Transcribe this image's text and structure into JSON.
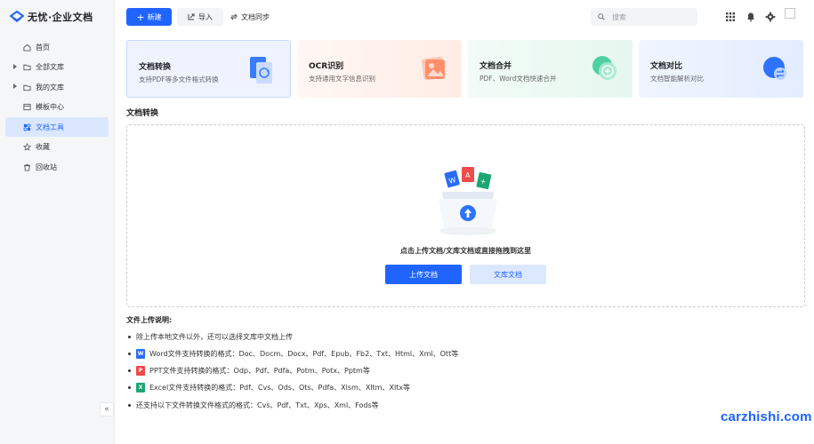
{
  "brand": {
    "name": "无忧·企业文档"
  },
  "sidebar": {
    "items": [
      {
        "label": "首页",
        "icon": "home-icon",
        "has_caret": false,
        "active": false
      },
      {
        "label": "全部文库",
        "icon": "folder-icon",
        "has_caret": true,
        "active": false
      },
      {
        "label": "我的文库",
        "icon": "folder-icon",
        "has_caret": true,
        "active": false
      },
      {
        "label": "模板中心",
        "icon": "template-icon",
        "has_caret": false,
        "active": false
      },
      {
        "label": "文档工具",
        "icon": "tools-icon",
        "has_caret": false,
        "active": true
      },
      {
        "label": "收藏",
        "icon": "star-icon",
        "has_caret": false,
        "active": false
      },
      {
        "label": "回收站",
        "icon": "trash-icon",
        "has_caret": false,
        "active": false
      }
    ],
    "collapse_label": "«"
  },
  "toolbar": {
    "new_label": "新建",
    "import_label": "导入",
    "sync_label": "文档同步",
    "search_placeholder": "搜索"
  },
  "cards": [
    {
      "title": "文档转换",
      "subtitle": "支持PDF等多文件格式转换",
      "icon": "convert-icon",
      "bg": "#eef3ff",
      "active": true
    },
    {
      "title": "OCR识别",
      "subtitle": "支持通用文字信息识别",
      "icon": "ocr-icon",
      "bg": "#fff3ef",
      "active": false
    },
    {
      "title": "文档合并",
      "subtitle": "PDF、Word文档快速合并",
      "icon": "merge-icon",
      "bg": "#eefaf5",
      "active": false
    },
    {
      "title": "文档对比",
      "subtitle": "文档智能解析对比",
      "icon": "compare-icon",
      "bg": "#eef3ff",
      "active": false
    }
  ],
  "section": {
    "title": "文档转换"
  },
  "dropzone": {
    "hint": "点击上传文档/文库文档或直接拖拽到这里",
    "upload_label": "上传文档",
    "library_label": "文库文档"
  },
  "notes": {
    "title": "文件上传说明:",
    "items": [
      {
        "text": "除上传本地文件以外，还可以选择文库中文档上传",
        "icon": ""
      },
      {
        "text": "Word文件支持转换的格式：Doc、Docm、Docx、Pdf、Epub、Fb2、Txt、Html、Xml、Ott等",
        "icon": "word-icon"
      },
      {
        "text": "PPT文件支持转换的格式：Odp、Pdf、Pdfa、Potm、Potx、Pptm等",
        "icon": "ppt-icon"
      },
      {
        "text": "Excel文件支持转换的格式：Pdf、Cvs、Ods、Ots、Pdfa、Xlsm、Xltm、Xltx等",
        "icon": "excel-icon"
      },
      {
        "text": "还支持以下文件转换文件格式的格式：Cvs、Pdf、Txt、Xps、Xml、Fods等",
        "icon": ""
      }
    ]
  },
  "watermark": {
    "text": "carzhishi.com"
  },
  "colors": {
    "accent": "#1f64ff",
    "word": "#2b6cf6",
    "ppt": "#ef4b4b",
    "excel": "#1ea672"
  }
}
